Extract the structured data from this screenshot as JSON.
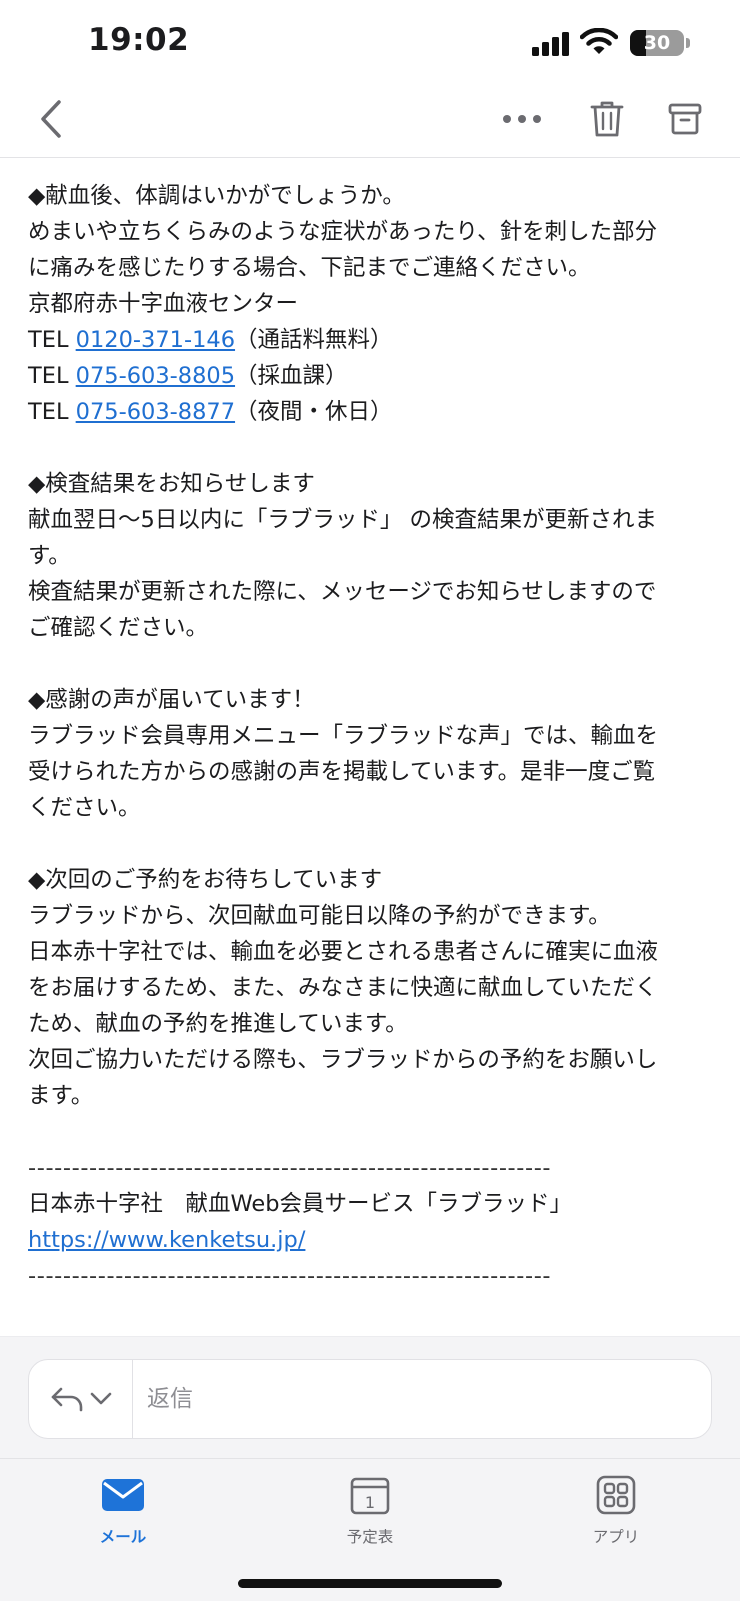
{
  "status_bar": {
    "time": "19:02",
    "battery_level": "30",
    "battery_fraction": 0.3,
    "icons": [
      "signal-icon",
      "wifi-icon",
      "battery-icon"
    ]
  },
  "toolbar": {
    "icons": [
      "chevron-left-icon",
      "more-icon",
      "trash-icon",
      "archive-icon"
    ]
  },
  "body": {
    "section1": {
      "heading": "◆献血後、体調はいかがでしょうか。",
      "lines": [
        "めまいや立ちくらみのような症状があったり、針を刺した部分",
        "に痛みを感じたりする場合、下記までご連絡ください。",
        "京都府赤十字血液センター"
      ],
      "tel_prefix": "TEL ",
      "tels": [
        {
          "number": "0120-371-146",
          "note": "（通話料無料）"
        },
        {
          "number": "075-603-8805",
          "note": "（採血課）"
        },
        {
          "number": "075-603-8877",
          "note": "（夜間・休日）"
        }
      ]
    },
    "section2": {
      "heading": "◆検査結果をお知らせします",
      "lines": [
        "献血翌日〜5日以内に「ラブラッド」 の検査結果が更新されま",
        "す。",
        "検査結果が更新された際に、メッセージでお知らせしますので",
        "ご確認ください。"
      ]
    },
    "section3": {
      "heading": "◆感謝の声が届いています！",
      "lines": [
        "ラブラッド会員専用メニュー「ラブラッドな声」では、輸血を",
        "受けられた方からの感謝の声を掲載しています。是非一度ご覧",
        "ください。"
      ]
    },
    "section4": {
      "heading": "◆次回のご予約をお待ちしています",
      "lines": [
        "ラブラッドから、次回献血可能日以降の予約ができます。",
        "日本赤十字社では、輸血を必要とされる患者さんに確実に血液",
        "をお届けするため、また、みなさまに快適に献血していただく",
        "ため、献血の予約を推進しています。",
        "次回ご協力いただける際も、ラブラッドからの予約をお願いし",
        "ます。"
      ]
    },
    "footer": {
      "divider": "------------------------------------------------------------",
      "org": "日本赤十字社　献血Web会員サービス「ラブラッド」",
      "url": "https://www.kenketsu.jp/"
    }
  },
  "reply": {
    "placeholder": "返信",
    "icons": [
      "reply-icon",
      "chevron-down-icon"
    ]
  },
  "tabs": [
    {
      "label": "メール",
      "icon": "mail-icon",
      "selected": true
    },
    {
      "label": "予定表",
      "icon": "calendar-icon",
      "day": "1",
      "selected": false
    },
    {
      "label": "アプリ",
      "icon": "apps-grid-icon",
      "selected": false
    }
  ],
  "colors": {
    "link": "#1f6fd1",
    "accent": "#1e73d8",
    "text": "#1c1c1e",
    "muted": "#6b6b70"
  }
}
